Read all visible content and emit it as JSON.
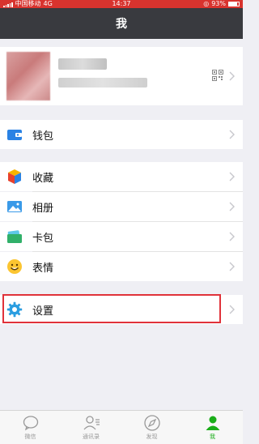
{
  "status_bar": {
    "carrier": "中国移动",
    "network": "4G",
    "time": "14:37",
    "battery": "93%"
  },
  "nav": {
    "title": "我"
  },
  "profile": {
    "qr_icon": "qr-code-icon"
  },
  "menu": {
    "wallet": {
      "label": "钱包",
      "icon": "wallet-icon"
    },
    "favorites": {
      "label": "收藏",
      "icon": "favorites-cube-icon"
    },
    "album": {
      "label": "相册",
      "icon": "album-landscape-icon"
    },
    "cards": {
      "label": "卡包",
      "icon": "card-wallet-icon"
    },
    "stickers": {
      "label": "表情",
      "icon": "smiley-icon"
    },
    "settings": {
      "label": "设置",
      "icon": "gear-icon"
    }
  },
  "tab_bar": {
    "tabs": [
      {
        "label": "微信",
        "icon": "chat-bubble-icon"
      },
      {
        "label": "通讯录",
        "icon": "contacts-icon"
      },
      {
        "label": "发现",
        "icon": "compass-icon"
      },
      {
        "label": "我",
        "icon": "person-icon"
      }
    ]
  },
  "colors": {
    "nav_bg": "#393a3f",
    "accent_green": "#1aad19",
    "highlight_red": "#e0323a"
  }
}
